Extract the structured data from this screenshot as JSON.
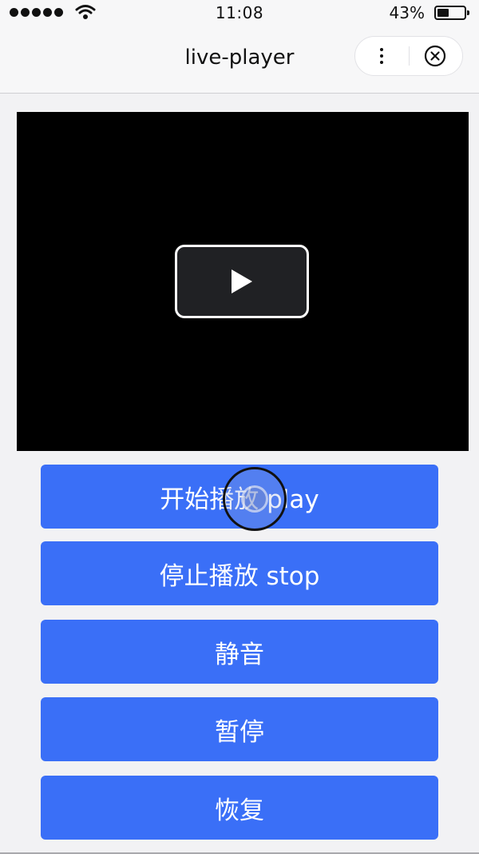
{
  "status_bar": {
    "time": "11:08",
    "battery_percent": "43%",
    "battery_level": 0.43,
    "signal_icon": "signal-dots-icon",
    "wifi_icon": "wifi-icon"
  },
  "nav": {
    "title": "live-player",
    "more_icon": "more-dots-icon",
    "close_icon": "circle-close-icon"
  },
  "player": {
    "play_icon": "play-icon",
    "background": "#000000"
  },
  "buttons": [
    {
      "label": "开始播放 play"
    },
    {
      "label": "停止播放 stop"
    },
    {
      "label": "静音"
    },
    {
      "label": "暂停"
    },
    {
      "label": "恢复"
    }
  ],
  "colors": {
    "accent": "#3a6ff7",
    "page_bg": "#f2f2f4"
  }
}
